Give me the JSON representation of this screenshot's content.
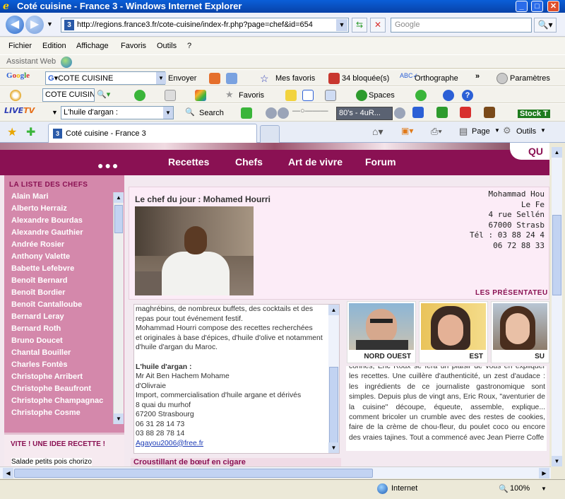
{
  "window": {
    "title": "Coté cuisine - France 3 - Windows Internet Explorer"
  },
  "address": {
    "url": "http://regions.france3.fr/cote-cuisine/index-fr.php?page=chef&id=654"
  },
  "search": {
    "placeholder": "Google"
  },
  "menu": [
    "Fichier",
    "Edition",
    "Affichage",
    "Favoris",
    "Outils",
    "?"
  ],
  "assistant": "Assistant Web",
  "google_toolbar": {
    "query": "COTE CUISINE",
    "send": "Envoyer",
    "favorites": "Mes favoris",
    "blocked": "34 bloquée(s)",
    "spelling": "Orthographe",
    "settings": "Paramètres"
  },
  "toolbar3": {
    "query": "COTE CUISINE",
    "favoris": "Favoris",
    "spaces": "Spaces"
  },
  "toolbar4": {
    "query": "L'huile d'argan :",
    "search": "Search",
    "radio": "80's - 4uR...",
    "stock": "Stock T"
  },
  "tabs": {
    "active": "Coté cuisine - France 3",
    "page": "Page",
    "outils": "Outils"
  },
  "site": {
    "nav": [
      "Recettes",
      "Chefs",
      "Art de vivre",
      "Forum"
    ],
    "corner": "QU",
    "chefs_heading": "LA LISTE DES CHEFS",
    "chefs": [
      "Alain Mari",
      "Alberto Herraiz",
      "Alexandre Bourdas",
      "Alexandre Gauthier",
      "Andrée Rosier",
      "Anthony Valette",
      "Babette Lefebvre",
      "Benoît Bernard",
      "Benoît Bordier",
      "Benoît Cantalloube",
      "Bernard Leray",
      "Bernard Roth",
      "Bruno Doucet",
      "Chantal Bouiller",
      "Charles Fontès",
      "Christophe Arribert",
      "Christophe Beaufront",
      "Christophe Champagnac",
      "Christophe Cosme"
    ],
    "vite_heading": "VITE ! UNE IDEE RECETTE !",
    "vite_item": "Salade petits pois chorizo",
    "chef_of_day": "Le chef du jour : Mohamed Hourri",
    "address_lines": [
      "Mohammad Hou",
      "Le Fe",
      "4 rue Sellén",
      "67000 Strasb",
      "Tél : 03 88 24 4",
      "06 72 88 33"
    ],
    "bio_lines": [
      "maghrébins, de nombreux buffets, des cocktails et des",
      "repas pour tout événement festif.",
      "Mohammad Hourri compose des recettes recherchées",
      "et originales à base d'épices, d'huile d'olive et notamment",
      "d'huile d'argan du Maroc."
    ],
    "argan_heading": "L'huile d'argan :",
    "argan_lines": [
      "Mr Ait Ben Hachem Mohame",
      "d'Olivraie",
      "Import, commercialisation d'huile argane et dérivés",
      "8 quai du murhof",
      "67200 Strasbourg",
      "06 31 28 14 73",
      "03 88 28 78 14"
    ],
    "email": "Agayou2006@free.fr",
    "next_recipe": "Croustillant de bœuf en cigare",
    "presenters_heading": "LES PRÉSENTATEU",
    "presenters": [
      "NORD OUEST",
      "EST",
      "SU"
    ],
    "presenter_text": "connes, Eric Roux se fera un plaisir de vous en expliquer les recettes. Une cuillère d'authenticité, un zest d'audace : les ingrédients de ce journaliste gastronomique sont simples. Depuis plus de vingt ans, Eric Roux, \"aventurier de la cuisine\" découpe, équeute, assemble, explique... comment bricoler un crumble avec des restes de cookies, faire de la crème de chou-fleur, du poulet coco ou encore des vraies tajines. Tout a commencé avec Jean Pierre Coffe"
  },
  "status": {
    "zone": "Internet",
    "zoom": "100%"
  }
}
